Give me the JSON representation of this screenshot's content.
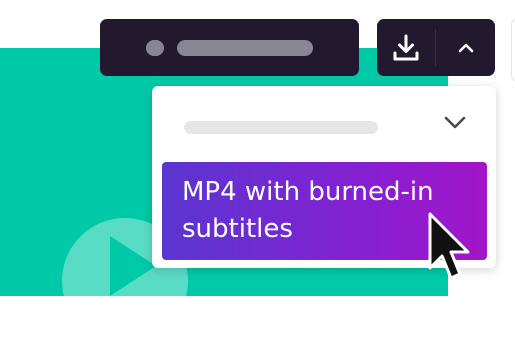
{
  "export_menu": {
    "selected_option": "MP4 with burned-in subtitles"
  },
  "icons": {
    "download": "download-icon",
    "collapse": "chevron-up-icon",
    "expand": "chevron-down-icon",
    "play": "play-icon",
    "cursor": "mouse-pointer-icon"
  },
  "colors": {
    "toolbar_bg": "#23192f",
    "video_bg": "#00c9a7",
    "option_gradient_start": "#5a36d0",
    "option_gradient_end": "#a215c8"
  }
}
